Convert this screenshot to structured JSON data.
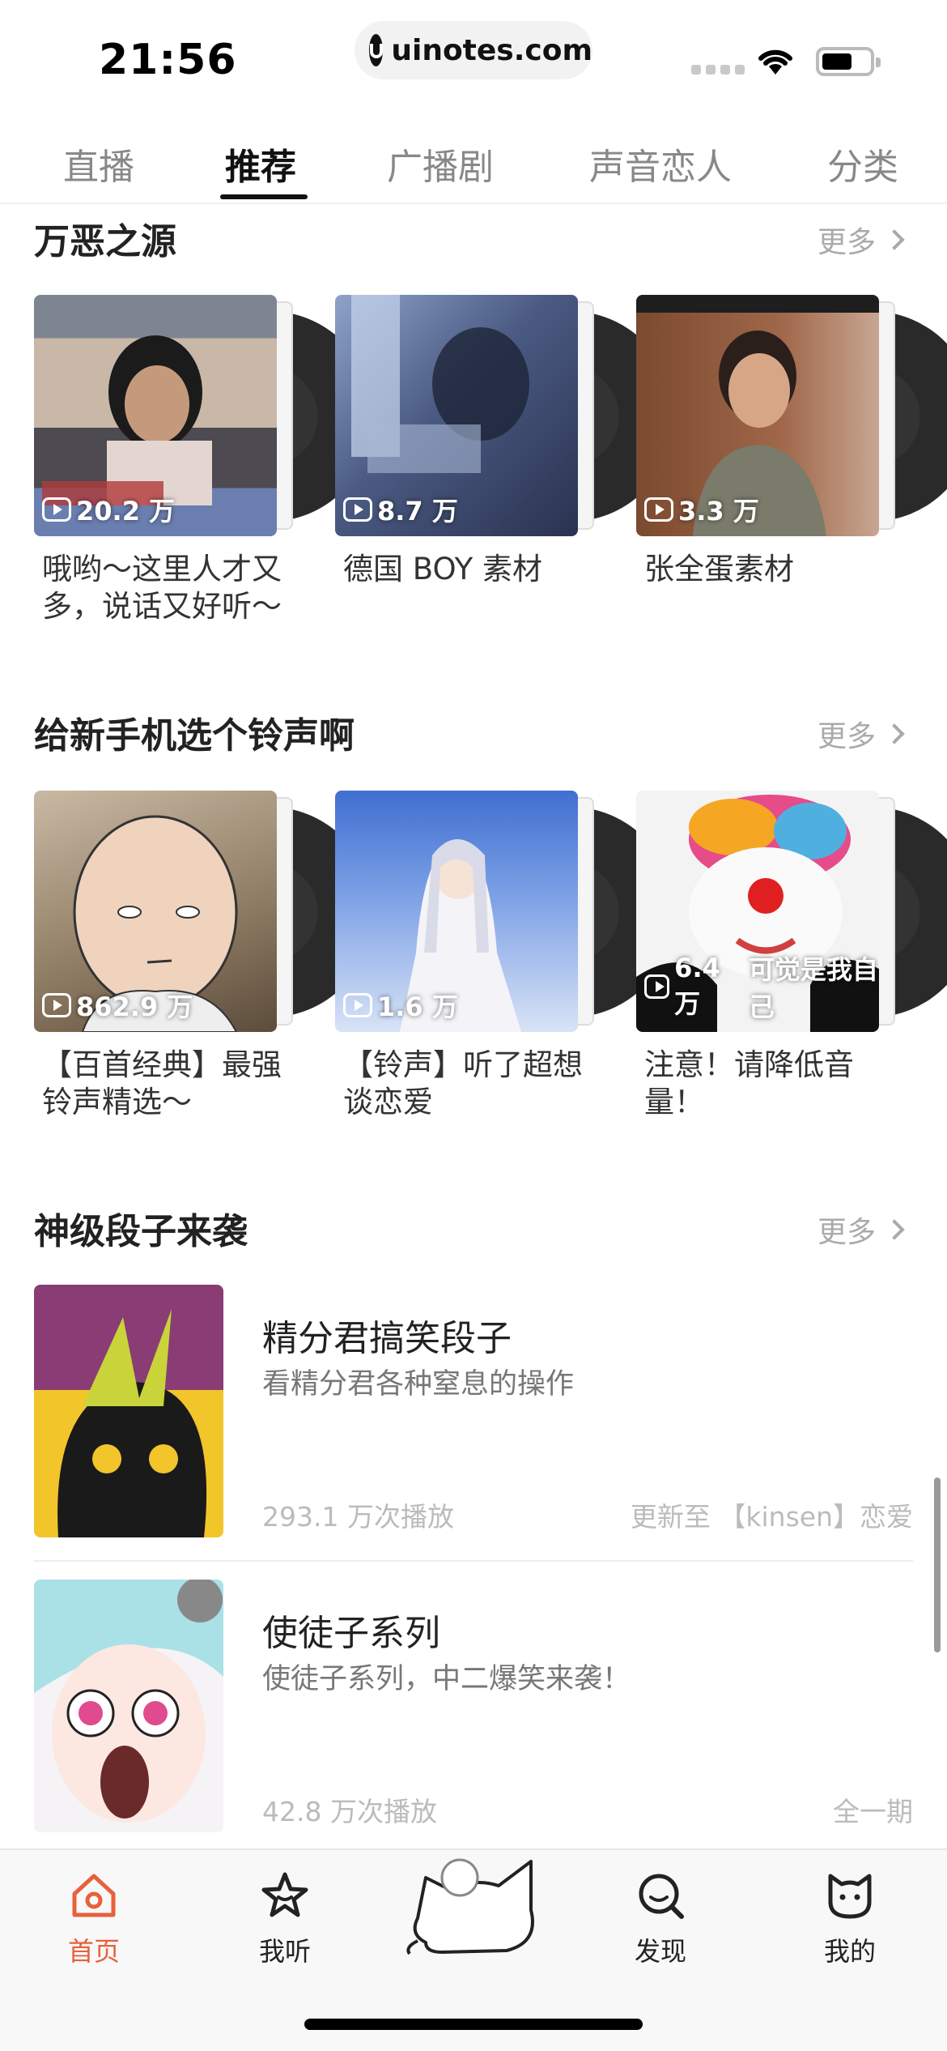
{
  "status": {
    "time": "21:56",
    "url": "uinotes.com"
  },
  "tabs": [
    {
      "label": "直播"
    },
    {
      "label": "推荐",
      "active": true
    },
    {
      "label": "广播剧"
    },
    {
      "label": "声音恋人"
    },
    {
      "label": "分类"
    }
  ],
  "sections": [
    {
      "title": "万恶之源",
      "more": "更多",
      "cards": [
        {
          "plays": "20.2 万",
          "title": "哦哟～这里人才又多，说话又好听～"
        },
        {
          "plays": "8.7 万",
          "title": "德国 BOY 素材"
        },
        {
          "plays": "3.3 万",
          "title": "张全蛋素材"
        }
      ]
    },
    {
      "title": "给新手机选个铃声啊",
      "more": "更多",
      "cards": [
        {
          "plays": "862.9 万",
          "title": "【百首经典】最强铃声精选～"
        },
        {
          "plays": "1.6 万",
          "title": "【铃声】听了超想谈恋爱"
        },
        {
          "plays": "6.4 万",
          "title": "注意！请降低音量！",
          "cover_text": "可觉是我自己"
        }
      ]
    },
    {
      "title": "神级段子来袭",
      "more": "更多",
      "list": [
        {
          "title": "精分君搞笑段子",
          "desc": "看精分君各种窒息的操作",
          "plays": "293.1 万次播放",
          "update": "更新至 【kinsen】恋爱"
        },
        {
          "title": "使徒子系列",
          "desc": "使徒子系列，中二爆笑来袭！",
          "plays": "42.8 万次播放",
          "update": "全一期"
        }
      ]
    }
  ],
  "nav": [
    {
      "label": "首页",
      "icon": "home-icon",
      "active": true
    },
    {
      "label": "我听",
      "icon": "star-icon"
    },
    {
      "label": "",
      "icon": "cat-mascot-icon"
    },
    {
      "label": "发现",
      "icon": "search-icon"
    },
    {
      "label": "我的",
      "icon": "cat-face-icon"
    }
  ],
  "colors": {
    "accent": "#e8603c",
    "text": "#222222",
    "muted": "#aaaaaa"
  }
}
